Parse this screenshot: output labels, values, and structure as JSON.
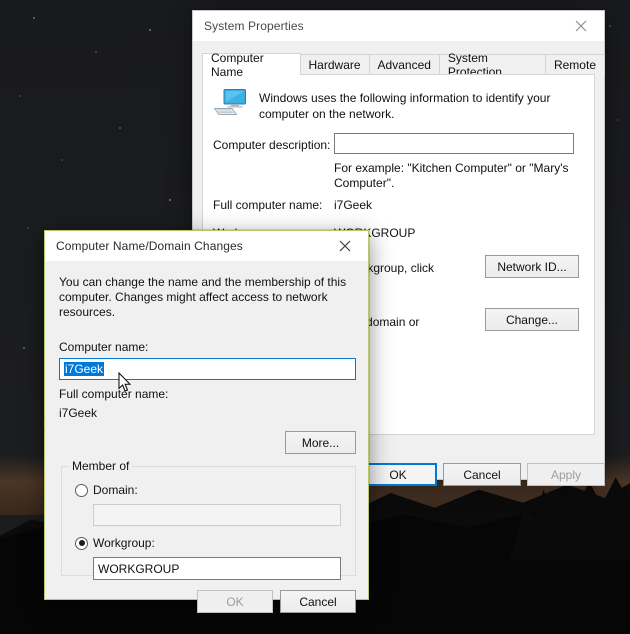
{
  "desktop": {
    "name": "windows-desktop-wallpaper"
  },
  "system_properties": {
    "title": "System Properties",
    "close_label": "✕",
    "tabs": [
      {
        "label": "Computer Name",
        "selected": true
      },
      {
        "label": "Hardware",
        "selected": false
      },
      {
        "label": "Advanced",
        "selected": false
      },
      {
        "label": "System Protection",
        "selected": false
      },
      {
        "label": "Remote",
        "selected": false
      }
    ],
    "intro_text": "Windows uses the following information to identify your computer on the network.",
    "computer_description_label": "Computer description:",
    "computer_description_value": "",
    "example_hint": "For example: \"Kitchen Computer\" or \"Mary's Computer\".",
    "full_computer_name_label": "Full computer name:",
    "full_computer_name_value": "i7Geek",
    "workgroup_label": "Workgroup:",
    "workgroup_value": "WORKGROUP",
    "network_id_hint": "or workgroup, click",
    "network_id_button": "Network ID...",
    "change_hint": "ge its domain or",
    "change_button": "Change...",
    "ok_button": "OK",
    "cancel_button": "Cancel",
    "apply_button": "Apply",
    "apply_disabled": true
  },
  "computer_name_dialog": {
    "title": "Computer Name/Domain Changes",
    "close_label": "✕",
    "description": "You can change the name and the membership of this computer. Changes might affect access to network resources.",
    "computer_name_label": "Computer name:",
    "computer_name_value": "i7Geek",
    "computer_name_selected": true,
    "full_computer_name_label": "Full computer name:",
    "full_computer_name_value": "i7Geek",
    "more_button": "More...",
    "member_of_label": "Member of",
    "domain_radio_label": "Domain:",
    "domain_selected": false,
    "domain_value": "",
    "workgroup_radio_label": "Workgroup:",
    "workgroup_selected": true,
    "workgroup_value": "WORKGROUP",
    "ok_button": "OK",
    "ok_disabled": true,
    "cancel_button": "Cancel"
  },
  "colors": {
    "accent": "#0078d7",
    "window_bg": "#f0f0f0",
    "panel_bg": "#ffffff",
    "active_border": "#b4c76a",
    "selection": "#0078d7"
  }
}
